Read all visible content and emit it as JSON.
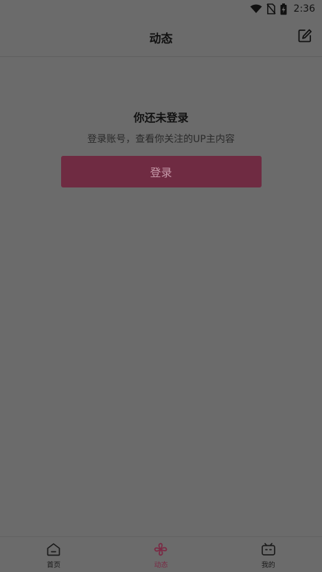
{
  "status_bar": {
    "time": "2:36",
    "icons": [
      "wifi-icon",
      "no-sim-icon",
      "battery-charging-icon"
    ]
  },
  "header": {
    "title": "动态",
    "edit_icon": "edit-icon"
  },
  "empty_state": {
    "title": "你还未登录",
    "subtitle": "登录账号，查看你关注的UP主内容",
    "login_label": "登录"
  },
  "bottom_nav": {
    "items": [
      {
        "label": "首页",
        "icon": "home-icon",
        "active": false
      },
      {
        "label": "动态",
        "icon": "pinwheel-icon",
        "active": true
      },
      {
        "label": "我的",
        "icon": "tv-icon",
        "active": false
      }
    ]
  },
  "colors": {
    "background": "#6b6b6b",
    "accent": "#7a2b45",
    "login_button": "#6f2b42"
  }
}
